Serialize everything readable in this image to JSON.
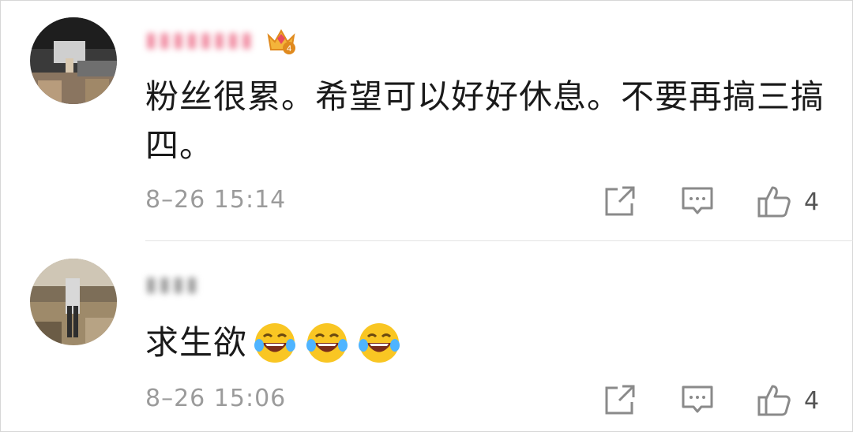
{
  "comments": [
    {
      "username": "▮▮▮▮▮▮▮▮",
      "has_badge": true,
      "badge_icon": "crown-level-4-icon",
      "text": "粉丝很累。希望可以好好休息。不要再搞三搞四。",
      "timestamp": "8–26 15:14",
      "likes": "4"
    },
    {
      "username": "▮▮▮▮",
      "text": "求生欲",
      "emoji": [
        "laugh-cry-emoji",
        "laugh-cry-emoji",
        "laugh-cry-emoji"
      ],
      "timestamp": "8–26 15:06",
      "likes": "4"
    }
  ],
  "colors": {
    "username_vip": "#f08aa0",
    "text": "#1a1a1a",
    "meta": "#9b9b9b",
    "icon": "#8a8a8a",
    "emoji_face": "#f9c623",
    "divider": "#e3e3e3"
  }
}
